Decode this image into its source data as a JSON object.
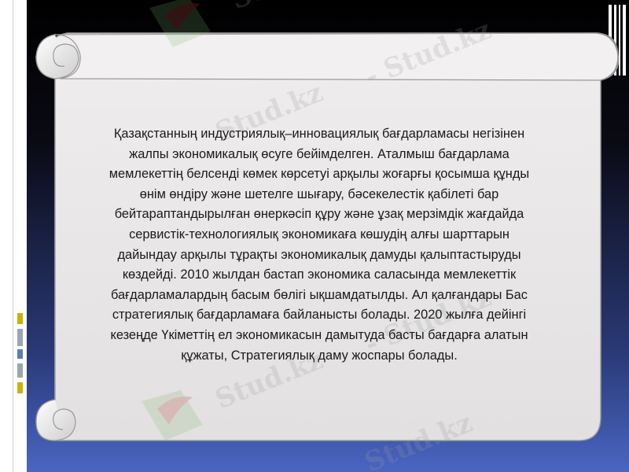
{
  "slide": {
    "body_text": "Қазақстанның индустриялық–инновациялық бағдарламасы негізінен жалпы экономикалық өсуге бейімделген. Аталмыш бағдарлама мемлекеттің белсенді көмек көрсетуі арқылы жоғарғы қосымша құнды өнім өндіру және шетелге шығару, бәсекелестік қабілеті бар бейтараптандырылған өнеркәсіп құру және ұзақ мерзімдік жағдайда сервистік-технологиялық экономикаға көшудің алғы шарттарын дайындау арқылы тұрақты экономикалық дамуды қалыптастыруды көздейді. 2010 жылдан бастап экономика саласында мемлекеттік бағдарламалардың басым бөлігі  ықшамдатылды. Ал қалғандары Бас стратегиялық бағдарламаға байланысты болады. 2020 жылға дейінгі кезеңде Үкіметтің ел экономикасын дамыту да басты бағдарға алатын құжаты, Стратегиялық даму жоспары болады.",
    "lines": [
      "Қазақстанның индустриялық–инновациялық бағдарламасы негізінен",
      "жалпы экономикалық өсуге бейімделген. Аталмыш бағдарлама",
      "мемлекеттің белсенді көмек көрсетуі арқылы жоғарғы қосымша құнды",
      "өнім өндіру және шетелге шығару, бәсекелестік қабілеті бар",
      "бейтараптандырылған өнеркәсіп құру және ұзақ мерзімдік жағдайда",
      "сервистік-технологиялық экономикаға көшудің алғы шарттарын",
      "дайындау арқылы тұрақты экономикалық дамуды қалыптастыруды",
      "көздейді. 2010 жылдан бастап экономика саласында мемлекеттік",
      "бағдарламалардың басым бөлігі  ықшамдатылды. Ал қалғандары Бас",
      "стратегиялық бағдарламаға байланысты болады. 2020 жылға дейінгі",
      "кезеңде Үкіметтің ел экономикасын дамытуда басты бағдарға алатын",
      "құжаты, Стратегиялық даму жоспары болады."
    ]
  },
  "watermark": {
    "text": "Stud.kz",
    "separator": "-",
    "icon": "hummingbird-logo-icon"
  },
  "colors": {
    "scroll_fill": "#e8e6e6",
    "scroll_edge": "#9a9a9a",
    "text": "#1a1a1a",
    "bg_top": "#000000",
    "bg_bottom": "#4a66c2",
    "mark_yellow": "#c8b400",
    "mark_blue": "#5a7fb0",
    "mark_gray": "#9aa6b2"
  }
}
